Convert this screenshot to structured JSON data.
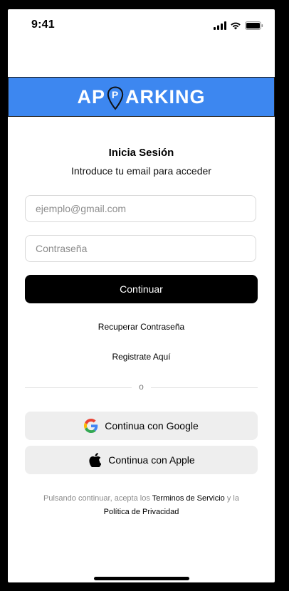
{
  "status_bar": {
    "time": "9:41"
  },
  "brand": {
    "prefix": "AP",
    "pin_letter": "P",
    "suffix": "ARKING",
    "color": "#3d87f0"
  },
  "login": {
    "title": "Inicia Sesión",
    "subtitle": "Introduce tu email para acceder",
    "email_placeholder": "ejemplo@gmail.com",
    "password_placeholder": "Contraseña",
    "continue_label": "Continuar",
    "recover_label": "Recuperar Contraseña",
    "register_label": "Registrate Aquí",
    "divider_text": "o"
  },
  "social": {
    "google_label": "Continua con Google",
    "apple_label": "Continua con Apple"
  },
  "terms": {
    "part1": "Pulsando continuar, acepta los ",
    "terms_link": "Terminos de Servicio",
    "part2": " y la ",
    "privacy_link": "Política de Privacidad"
  }
}
